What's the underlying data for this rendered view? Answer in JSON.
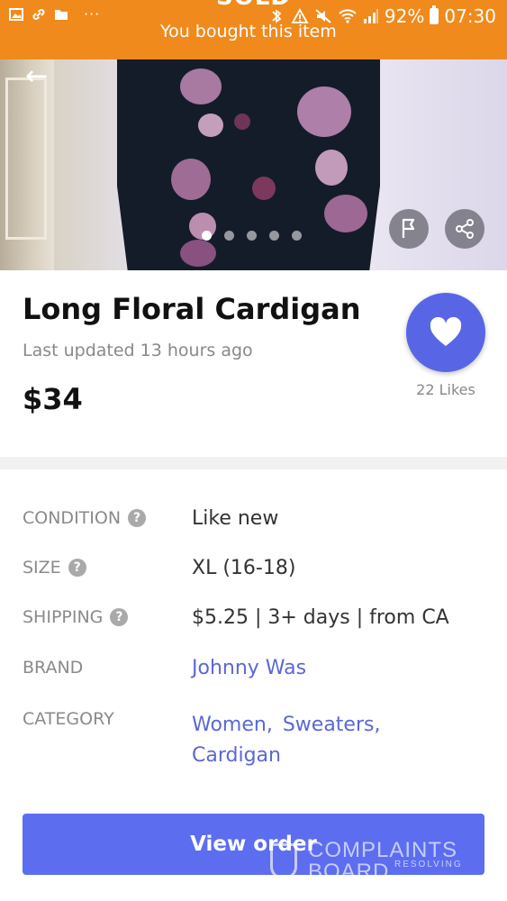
{
  "status_bar": {
    "battery": "92%",
    "time": "07:30",
    "overflow": "···"
  },
  "banner": {
    "sold": "SOLD",
    "message": "You bought this item"
  },
  "gallery": {
    "image_count": 5,
    "active_index": 0
  },
  "listing": {
    "title": "Long Floral Cardigan",
    "updated": "Last updated 13 hours ago",
    "price": "$34",
    "likes": "22 Likes"
  },
  "details": {
    "condition": {
      "label": "CONDITION",
      "value": "Like new"
    },
    "size": {
      "label": "SIZE",
      "value": "XL (16-18)"
    },
    "shipping": {
      "label": "SHIPPING",
      "value": "$5.25 | 3+ days | from CA"
    },
    "brand": {
      "label": "BRAND",
      "value": "Johnny Was"
    },
    "category": {
      "label": "CATEGORY",
      "values": [
        "Women,",
        "Sweaters,",
        "Cardigan"
      ]
    }
  },
  "actions": {
    "view_order": "View order"
  },
  "watermark": {
    "line1": "COMPLAINTS",
    "line2": "BOARD",
    "tagline": "RESOLVING"
  },
  "colors": {
    "banner": "#f08a1c",
    "accent": "#5866e6",
    "link": "#5a67d8",
    "button": "#5c6df0"
  }
}
